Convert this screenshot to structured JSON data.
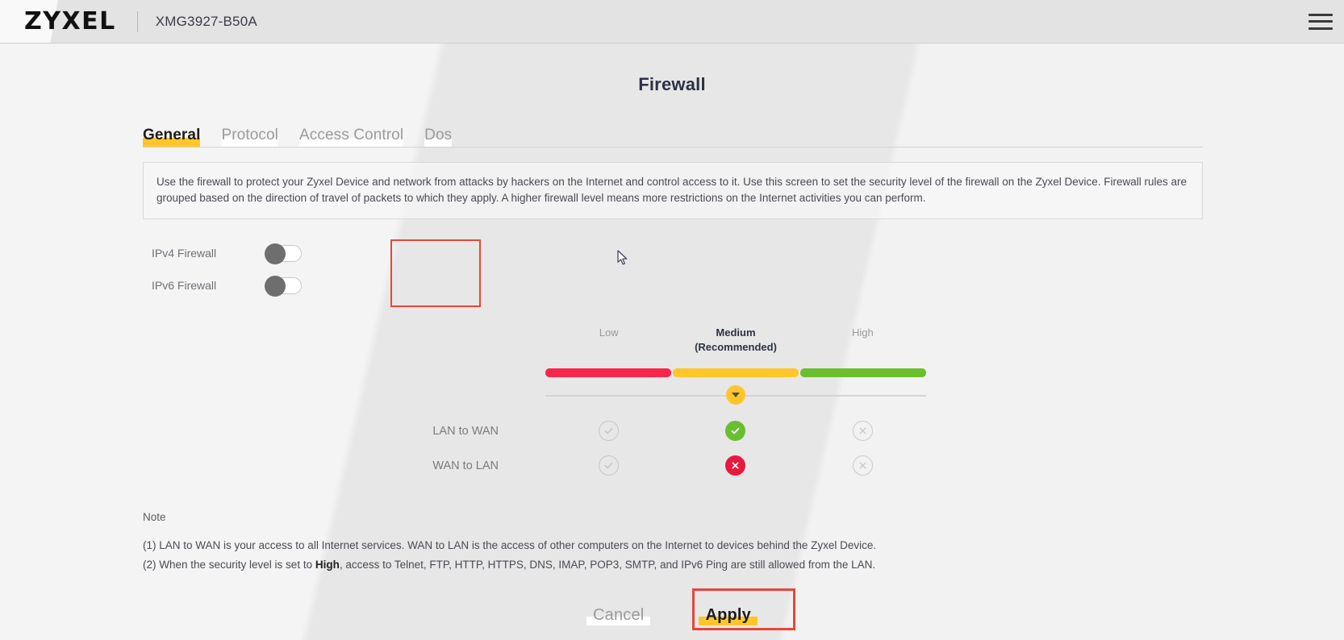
{
  "header": {
    "logo_text": "ZYXEL",
    "model": "XMG3927-B50A",
    "menu_icon": "hamburger-menu-icon"
  },
  "page": {
    "title": "Firewall"
  },
  "tabs": [
    {
      "label": "General",
      "active": true
    },
    {
      "label": "Protocol",
      "active": false
    },
    {
      "label": "Access Control",
      "active": false
    },
    {
      "label": "Dos",
      "active": false
    }
  ],
  "description": "Use the firewall to protect your Zyxel Device and network from attacks by hackers on the Internet and control access to it. Use this screen to set the security level of the firewall on the Zyxel Device. Firewall rules are grouped based on the direction of travel of packets to which they apply. A higher firewall level means more restrictions on the Internet activities you can perform.",
  "toggles": [
    {
      "label": "IPv4 Firewall",
      "state": "off"
    },
    {
      "label": "IPv6 Firewall",
      "state": "off"
    }
  ],
  "security_levels": {
    "columns": [
      {
        "label_line1": "Low",
        "label_line2": "",
        "selected": false,
        "color": "#f8264a"
      },
      {
        "label_line1": "Medium",
        "label_line2": "(Recommended)",
        "selected": true,
        "color": "#ffc62b"
      },
      {
        "label_line1": "High",
        "label_line2": "",
        "selected": false,
        "color": "#6bbf2f"
      }
    ],
    "selected_index": 1,
    "thumb_icon": "chevron-down-icon"
  },
  "rules": [
    {
      "name": "LAN to WAN",
      "cells": [
        {
          "icon": "check-icon",
          "state": "inactive"
        },
        {
          "icon": "check-icon",
          "state": "active-allow"
        },
        {
          "icon": "cross-icon",
          "state": "inactive"
        }
      ]
    },
    {
      "name": "WAN to LAN",
      "cells": [
        {
          "icon": "check-icon",
          "state": "inactive"
        },
        {
          "icon": "cross-icon",
          "state": "active-block"
        },
        {
          "icon": "cross-icon",
          "state": "inactive"
        }
      ]
    }
  ],
  "note": {
    "title": "Note",
    "line1": "(1) LAN to WAN is your access to all Internet services. WAN to LAN is the access of other computers on the Internet to devices behind the Zyxel Device.",
    "line2_before": "(2) When the security level is set to ",
    "line2_bold": "High",
    "line2_after": ", access to Telnet, FTP, HTTP, HTTPS, DNS, IMAP, POP3, SMTP, and IPv6 Ping are still allowed from the LAN."
  },
  "buttons": {
    "cancel": "Cancel",
    "apply": "Apply"
  },
  "colors": {
    "accent_yellow": "#ffc62b",
    "annotation_red": "#e8453c",
    "level_low": "#f8264a",
    "level_medium": "#ffc62b",
    "level_high": "#6bbf2f",
    "allow_green": "#6bbf2f",
    "block_red": "#e8193c"
  }
}
